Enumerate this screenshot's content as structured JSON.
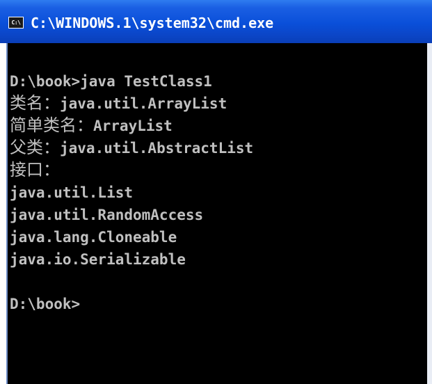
{
  "window": {
    "title": "C:\\WINDOWS.1\\system32\\cmd.exe",
    "icon_label": "C:\\",
    "icon": "console-icon"
  },
  "console": {
    "lines": [
      {
        "label": "",
        "text": "D:\\book>java TestClass1"
      },
      {
        "label": "类名：",
        "text": "java.util.ArrayList"
      },
      {
        "label": "简单类名：",
        "text": "ArrayList"
      },
      {
        "label": "父类：",
        "text": "java.util.AbstractList"
      },
      {
        "label": "接口：",
        "text": ""
      },
      {
        "label": "",
        "text": "java.util.List"
      },
      {
        "label": "",
        "text": "java.util.RandomAccess"
      },
      {
        "label": "",
        "text": "java.lang.Cloneable"
      },
      {
        "label": "",
        "text": "java.io.Serializable"
      },
      {
        "label": "",
        "text": ""
      },
      {
        "label": "",
        "text": "D:\\book>"
      }
    ]
  },
  "colors": {
    "titlebar": "#0a4fd9",
    "console_bg": "#000000",
    "console_text": "#c0c0c0"
  }
}
